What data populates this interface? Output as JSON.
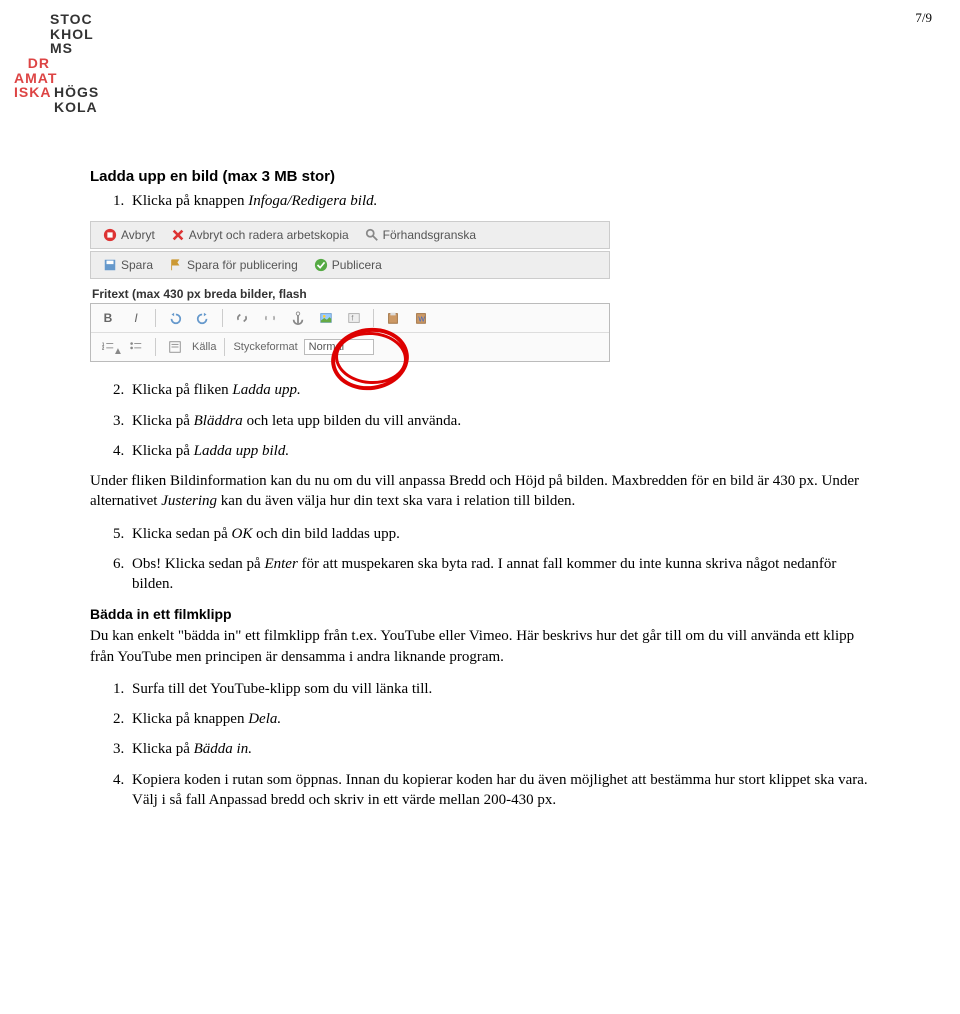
{
  "page_number": "7/9",
  "logo": {
    "line1": "STOC",
    "line2": "KHOL",
    "line3": "MS",
    "line4": "DR",
    "line5": "AMAT",
    "line6": "ISKA",
    "line7": "HÖGS",
    "line8": "KOLA"
  },
  "heading1": "Ladda upp en bild (max 3 MB stor)",
  "list1": {
    "i1_a": "Klicka på knappen ",
    "i1_b": "Infoga/Redigera bild.",
    "i2_a": "Klicka på fliken ",
    "i2_b": "Ladda upp.",
    "i3_a": "Klicka på ",
    "i3_b": "Bläddra",
    "i3_c": " och leta upp bilden du vill använda.",
    "i4_a": "Klicka på ",
    "i4_b": "Ladda upp bild."
  },
  "para1_a": "Under fliken Bildinformation kan du nu om du vill anpassa Bredd och Höjd på bilden. Maxbredden för en bild är 430 px. Under alternativet ",
  "para1_b": "Justering",
  "para1_c": " kan du även välja hur din text ska vara i relation till bilden.",
  "list1b": {
    "i5_a": "Klicka sedan på ",
    "i5_b": "OK",
    "i5_c": " och din bild laddas upp.",
    "i6_a": "Obs! Klicka sedan på ",
    "i6_b": "Enter",
    "i6_c": " för att muspekaren ska byta rad. I annat fall kommer du inte kunna skriva något nedanför bilden."
  },
  "heading2": "Bädda in ett filmklipp",
  "para2": "Du kan enkelt \"bädda in\" ett filmklipp från t.ex. YouTube eller Vimeo. Här beskrivs hur det går till om du vill använda ett klipp från YouTube men principen är densamma i andra liknande program.",
  "list2": {
    "i1": "Surfa till det YouTube-klipp som du vill länka till.",
    "i2_a": "Klicka på knappen ",
    "i2_b": "Dela.",
    "i3_a": "Klicka på ",
    "i3_b": "Bädda in.",
    "i4": "Kopiera koden i rutan som öppnas. Innan du kopierar koden har du även möjlighet att bestämma hur stort klippet ska vara. Välj i så fall Anpassad bredd och skriv in ett värde mellan 200-430 px."
  },
  "toolbar": {
    "avbryt": "Avbryt",
    "avbryt_radera": "Avbryt och radera arbetskopia",
    "forhandsgranska": "Förhandsgranska",
    "spara": "Spara",
    "spara_pub": "Spara för publicering",
    "publicera": "Publicera",
    "fritext": "Fritext (max 430 px breda bilder, flash",
    "kalla": "Källa",
    "styckeformat": "Styckeformat",
    "normal": "Normal"
  }
}
